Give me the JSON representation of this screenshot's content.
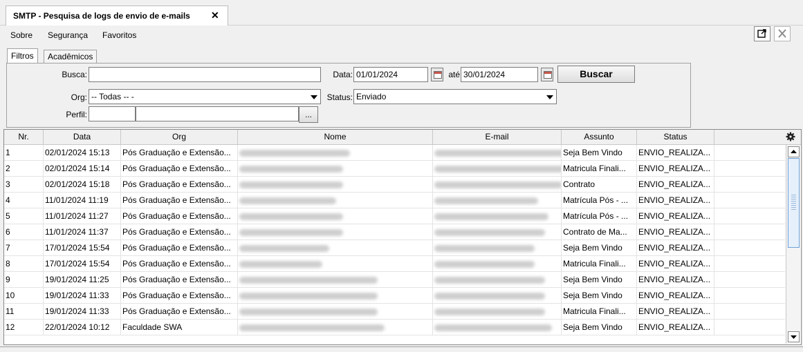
{
  "window": {
    "tab_title": "SMTP - Pesquisa de logs de envio de e-mails",
    "close_glyph": "✕"
  },
  "menu": [
    {
      "label": "Sobre"
    },
    {
      "label": "Segurança"
    },
    {
      "label": "Favoritos"
    }
  ],
  "toolbar_icons": [
    "popout-icon",
    "close-window-icon"
  ],
  "subtabs": [
    {
      "label": "Filtros",
      "active": true
    },
    {
      "label": "Acadêmicos",
      "active": false
    }
  ],
  "filters": {
    "busca_label": "Busca:",
    "busca_value": "",
    "data_label": "Data:",
    "data_from": "01/01/2024",
    "ate_label": "até",
    "data_to": "30/01/2024",
    "search_button": "Buscar",
    "org_label": "Org:",
    "org_value": "-- Todas -- -",
    "status_label": "Status:",
    "status_value": "Enviado",
    "perfil_label": "Perfil:",
    "perfil_code": "",
    "perfil_name": "",
    "perfil_button": "..."
  },
  "table": {
    "columns": [
      "Nr.",
      "Data",
      "Org",
      "Nome",
      "E-mail",
      "Assunto",
      "Status"
    ],
    "rows": [
      {
        "nr": "1",
        "data": "02/01/2024 15:13",
        "org": "Pós Graduação e Extensão...",
        "assunto": "Seja Bem Vindo",
        "status": "ENVIO_REALIZA..."
      },
      {
        "nr": "2",
        "data": "02/01/2024 15:14",
        "org": "Pós Graduação e Extensão...",
        "assunto": "Matricula Finali...",
        "status": "ENVIO_REALIZA..."
      },
      {
        "nr": "3",
        "data": "02/01/2024 15:18",
        "org": "Pós Graduação e Extensão...",
        "assunto": "Contrato",
        "status": "ENVIO_REALIZA..."
      },
      {
        "nr": "4",
        "data": "11/01/2024 11:19",
        "org": "Pós Graduação e Extensão...",
        "assunto": "Matrícula Pós - ...",
        "status": "ENVIO_REALIZA..."
      },
      {
        "nr": "5",
        "data": "11/01/2024 11:27",
        "org": "Pós Graduação e Extensão...",
        "assunto": "Matrícula Pós - ...",
        "status": "ENVIO_REALIZA..."
      },
      {
        "nr": "6",
        "data": "11/01/2024 11:37",
        "org": "Pós Graduação e Extensão...",
        "assunto": "Contrato de Ma...",
        "status": "ENVIO_REALIZA..."
      },
      {
        "nr": "7",
        "data": "17/01/2024 15:54",
        "org": "Pós Graduação e Extensão...",
        "assunto": "Seja Bem Vindo",
        "status": "ENVIO_REALIZA..."
      },
      {
        "nr": "8",
        "data": "17/01/2024 15:54",
        "org": "Pós Graduação e Extensão...",
        "assunto": "Matricula Finali...",
        "status": "ENVIO_REALIZA..."
      },
      {
        "nr": "9",
        "data": "19/01/2024 11:25",
        "org": "Pós Graduação e Extensão...",
        "assunto": "Seja Bem Vindo",
        "status": "ENVIO_REALIZA..."
      },
      {
        "nr": "10",
        "data": "19/01/2024 11:33",
        "org": "Pós Graduação e Extensão...",
        "assunto": "Seja Bem Vindo",
        "status": "ENVIO_REALIZA..."
      },
      {
        "nr": "11",
        "data": "19/01/2024 11:33",
        "org": "Pós Graduação e Extensão...",
        "assunto": "Matricula Finali...",
        "status": "ENVIO_REALIZA..."
      },
      {
        "nr": "12",
        "data": "22/01/2024 10:12",
        "org": "Faculdade SWA",
        "assunto": "Seja Bem Vindo",
        "status": "ENVIO_REALIZA..."
      }
    ]
  },
  "colors": {
    "accent": "#6fa0d6",
    "background": "#f0f0f0"
  }
}
